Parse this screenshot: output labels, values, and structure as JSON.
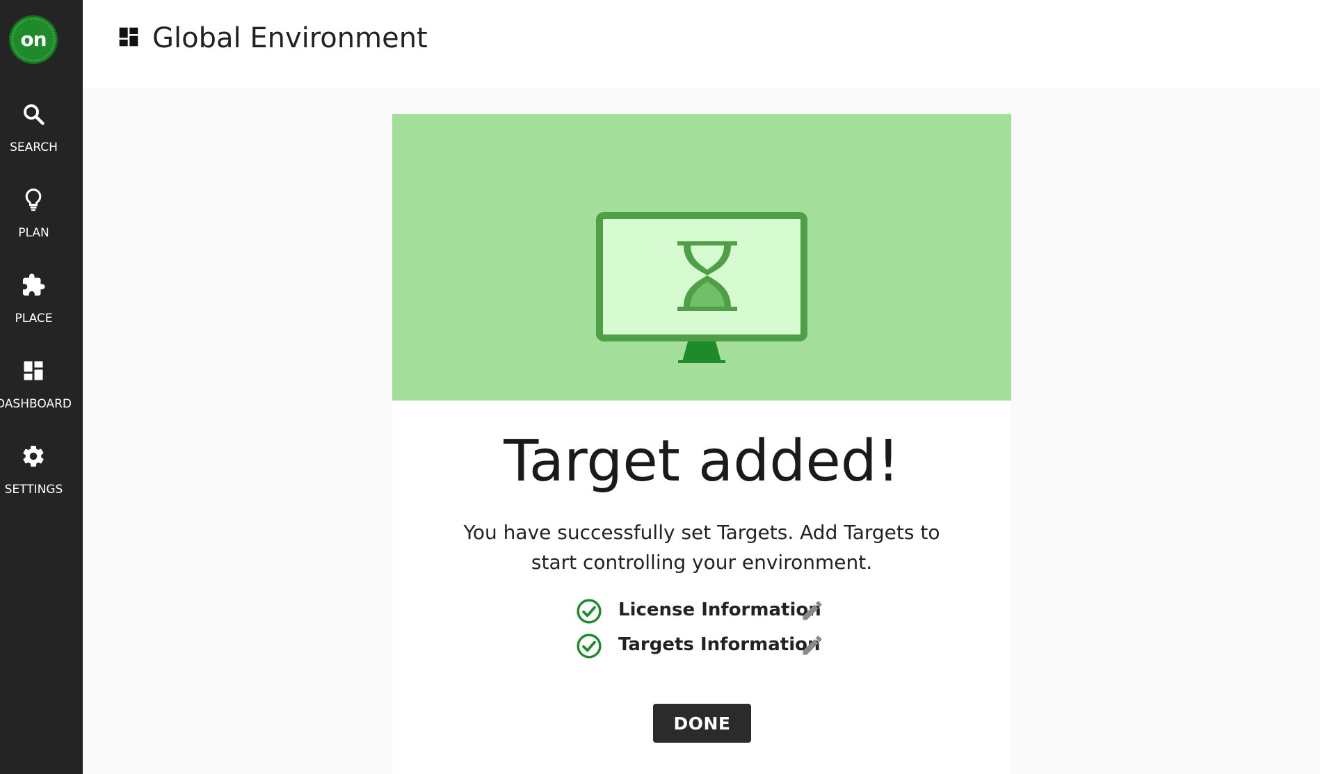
{
  "app": {
    "logo_text": "on",
    "page_title": "Global Environment"
  },
  "sidebar": {
    "items": [
      {
        "label": "SEARCH",
        "icon": "search-icon"
      },
      {
        "label": "PLAN",
        "icon": "lightbulb-icon"
      },
      {
        "label": "PLACE",
        "icon": "puzzle-icon"
      },
      {
        "label": "DASHBOARD",
        "icon": "dashboard-icon"
      },
      {
        "label": "SETTINGS",
        "icon": "gear-icon"
      }
    ]
  },
  "card": {
    "illustration": "monitor-hourglass-icon",
    "title": "Target added!",
    "message": "You have successfully set Targets. Add Targets to start controlling your environment.",
    "steps": [
      {
        "label": "License Information",
        "status": "complete",
        "icon": "check-circle-icon",
        "action_icon": "pencil-icon"
      },
      {
        "label": "Targets Information",
        "status": "complete",
        "icon": "check-circle-icon",
        "action_icon": "pencil-icon"
      }
    ],
    "done_label": "DONE"
  },
  "colors": {
    "sidebar_bg": "#242424",
    "banner_bg": "#a3de9b",
    "brand_green": "#1f8a2a",
    "check_green": "#1f8a2a",
    "button_bg": "#2b2b2b"
  }
}
